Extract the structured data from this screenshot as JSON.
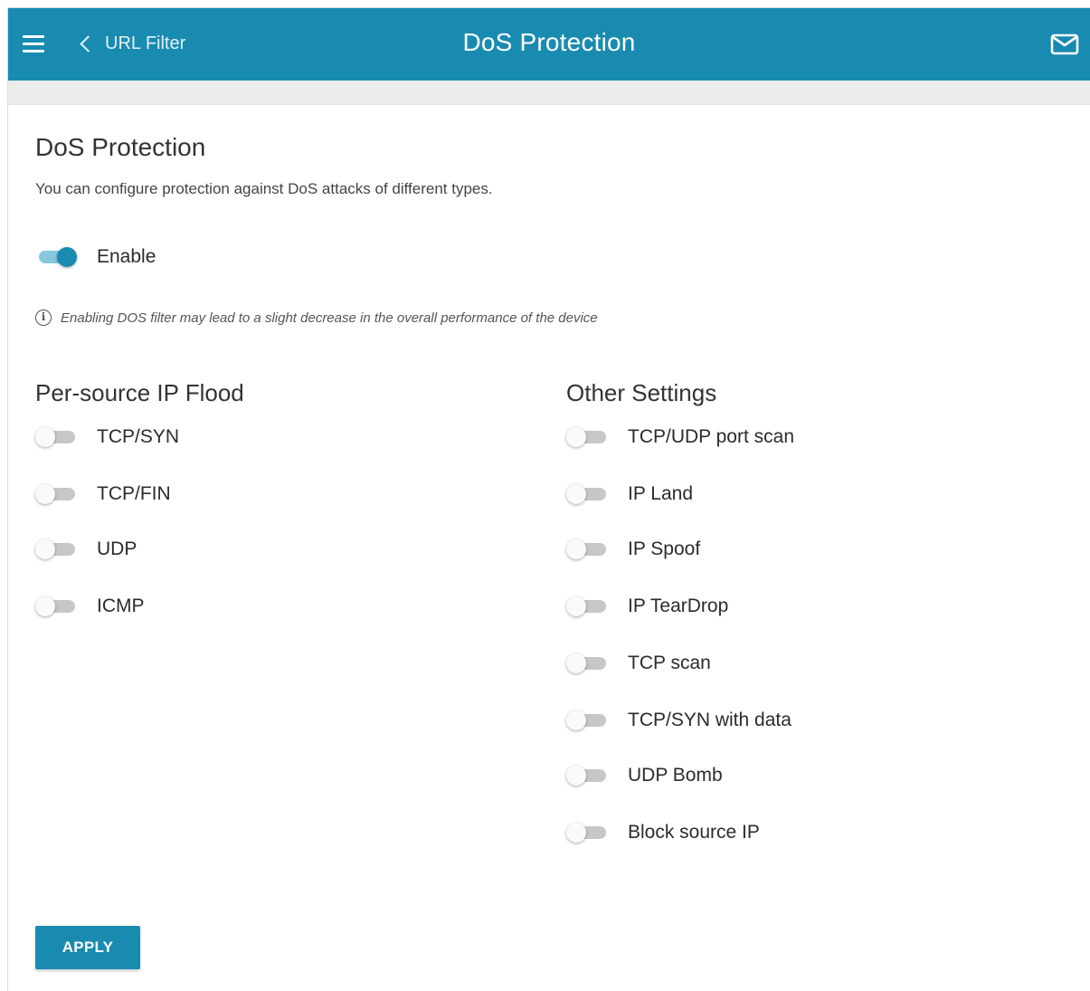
{
  "header": {
    "back_label": "URL Filter",
    "title": "DoS Protection",
    "menu_icon": "hamburger-menu-icon",
    "mail_icon": "mail-icon"
  },
  "main": {
    "title": "DoS Protection",
    "description": "You can configure protection against DoS attacks of different types.",
    "enable": {
      "label": "Enable",
      "checked": true
    },
    "info_note": "Enabling DOS filter may lead to a slight decrease in the overall performance of the device"
  },
  "per_source": {
    "heading": "Per-source IP Flood",
    "items": [
      {
        "label": "TCP/SYN",
        "checked": false
      },
      {
        "label": "TCP/FIN",
        "checked": false
      },
      {
        "label": "UDP",
        "checked": false
      },
      {
        "label": "ICMP",
        "checked": false
      }
    ]
  },
  "other": {
    "heading": "Other Settings",
    "items": [
      {
        "label": "TCP/UDP port scan",
        "checked": false
      },
      {
        "label": "IP Land",
        "checked": false
      },
      {
        "label": "IP Spoof",
        "checked": false
      },
      {
        "label": "IP TearDrop",
        "checked": false
      },
      {
        "label": "TCP scan",
        "checked": false
      },
      {
        "label": "TCP/SYN with data",
        "checked": false
      },
      {
        "label": "UDP Bomb",
        "checked": false
      },
      {
        "label": "Block source IP",
        "checked": false
      }
    ]
  },
  "actions": {
    "apply_label": "APPLY"
  },
  "colors": {
    "accent": "#1a8bb0",
    "toggle_on_track": "#86c8de",
    "toggle_off_track": "#c7c7c7"
  }
}
